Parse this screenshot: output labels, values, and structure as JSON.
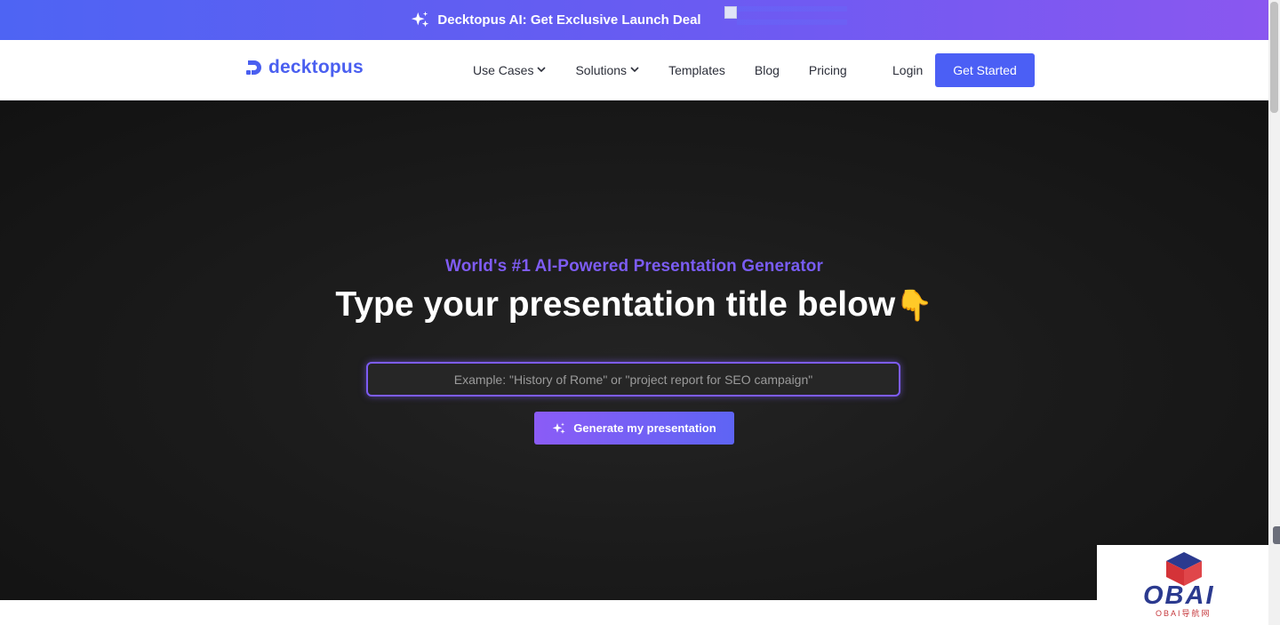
{
  "banner": {
    "text": "Decktopus AI: Get Exclusive Launch Deal"
  },
  "navbar": {
    "logo_text": "decktopus",
    "links": [
      {
        "label": "Use Cases"
      },
      {
        "label": "Solutions"
      },
      {
        "label": "Templates"
      },
      {
        "label": "Blog"
      },
      {
        "label": "Pricing"
      }
    ],
    "login_label": "Login",
    "get_started_label": "Get Started"
  },
  "hero": {
    "eyebrow": "World's #1 AI-Powered Presentation Generator",
    "headline": "Type your presentation title below",
    "headline_emoji": "👇",
    "input_placeholder": "Example: \"History of Rome\" or \"project report for SEO campaign\"",
    "input_value": "",
    "generate_label": "Generate my presentation"
  },
  "watermark": {
    "brand": "OBAI",
    "sub": "OBAI导航网"
  },
  "colors": {
    "accent": "#4b5ff5",
    "purple": "#8b5cf6",
    "hero_bg": "#1b1b1b"
  },
  "icons": {
    "banner": "sparkle-icon",
    "logo": "decktopus-logo-icon",
    "dropdown": "chevron-down-icon",
    "generate": "sparkle-icon"
  }
}
